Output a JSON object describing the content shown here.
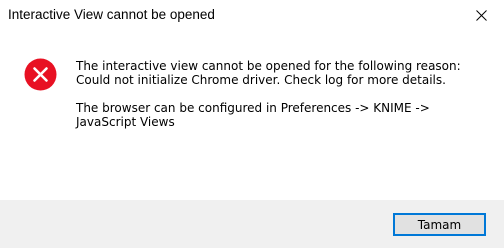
{
  "window": {
    "title": "Interactive View cannot be opened",
    "close_icon": "close-icon"
  },
  "message": {
    "icon": "error-icon",
    "icon_color": "#e81123",
    "line1": "The interactive view cannot be opened for the following reason:",
    "line2": "Could not initialize Chrome driver. Check log for more details.",
    "line3": "The browser can be configured in Preferences -> KNIME -> JavaScript Views"
  },
  "footer": {
    "ok_label": "Tamam"
  },
  "colors": {
    "accent": "#0078d7",
    "footer_bg": "#f0f0f0"
  }
}
